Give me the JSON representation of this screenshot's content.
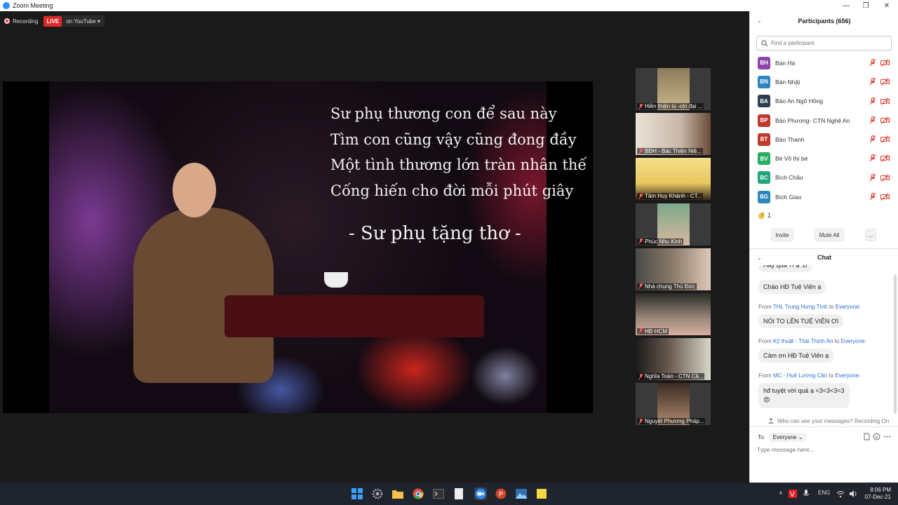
{
  "window": {
    "title": "Zoom Meeting"
  },
  "recording": {
    "label": "Recording",
    "live_badge": "LIVE",
    "live_target": "on YouTube"
  },
  "slide": {
    "poem_lines": [
      "Sư phụ thương con để sau này",
      "Tìm con cũng vậy cũng đong đầy",
      "Một tình thương lớn tràn nhân thế",
      "Cống hiến cho đời mỗi phút giây"
    ],
    "signature": "- Sư phụ tặng thơ -"
  },
  "videos": [
    {
      "name": "Hiền thiện tú -ctn đại ..."
    },
    {
      "name": "BĐH - Bác Thiện Niệ..."
    },
    {
      "name": "Tâm Huy Khánh - CT..."
    },
    {
      "name": "Phúc Nhu Kinh"
    },
    {
      "name": "Nhà chung Thủ Đức"
    },
    {
      "name": "HĐ HCM"
    },
    {
      "name": "Nghĩa Toàn - CTN Cầ..."
    },
    {
      "name": "Nguyệt Phương Pháp..."
    }
  ],
  "participants": {
    "title": "Participants (656)",
    "search_placeholder": "Find a participant",
    "list": [
      {
        "initials": "BH",
        "name": "Bản Hà",
        "color": "#8e44ad"
      },
      {
        "initials": "BN",
        "name": "Bản Nhật",
        "color": "#2e86c1"
      },
      {
        "initials": "BA",
        "name": "Bảo An Ngô Hồng",
        "color": "#2c3e50"
      },
      {
        "initials": "BP",
        "name": "Bảo Phương- CTN Nghệ An",
        "color": "#c0392b"
      },
      {
        "initials": "BT",
        "name": "Bảo Thanh",
        "color": "#c0392b"
      },
      {
        "initials": "BV",
        "name": "Bé Võ thị bé",
        "color": "#27ae60"
      },
      {
        "initials": "BC",
        "name": "Bích Châu",
        "color": "#1fa67a"
      },
      {
        "initials": "BG",
        "name": "Bích Giao",
        "color": "#2e86c1"
      }
    ],
    "reaction_count": "1",
    "invite_label": "Invite",
    "mute_all_label": "Mute All",
    "more_label": "..."
  },
  "chat": {
    "title": "Chat",
    "partial_message": "Hay quá Tí ạ :D",
    "messages": [
      {
        "text": "Chào HĐ Tuệ Viên ạ"
      },
      {
        "from_prefix": "From",
        "sender": "THL Trung Hưng Tình",
        "to_word": "to",
        "recipient": "Everyone:",
        "text": "NÓI TO LÊN TUỆ VIÊN ƠI"
      },
      {
        "from_prefix": "From",
        "sender": "Kỹ thuật - Thái Thịnh An",
        "to_word": "to",
        "recipient": "Everyone:",
        "text": "Cảm ơn HĐ Tuệ Viên ạ"
      },
      {
        "from_prefix": "From",
        "sender": "MC - Huệ Lương Cần",
        "to_word": "to",
        "recipient": "Everyone:",
        "text": "hđ tuyệt vời quá ạ <3<3<3<3",
        "emoji": "😍"
      }
    ],
    "who_can_see": "Who can see your messages? Recording On",
    "to_label": "To:",
    "to_value": "Everyone",
    "input_placeholder": "Type message here..."
  },
  "taskbar": {
    "language": "ENG",
    "time": "8:06 PM",
    "date": "07-Dec-21"
  },
  "colors": {
    "accent": "#2d8cff",
    "live": "#e02828",
    "muted": "#e0392b"
  }
}
